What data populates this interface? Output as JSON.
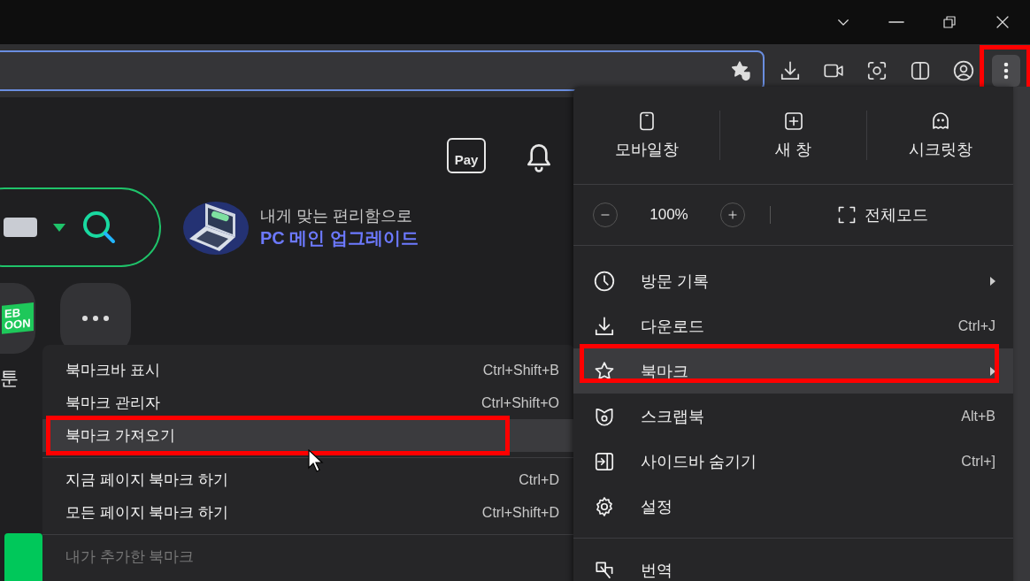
{
  "toolbar": {
    "menu_button": {
      "annotated": true
    }
  },
  "page": {
    "pay_label": "Pay",
    "banner": {
      "line_1": "내게 맞는 편리함으로",
      "line_2": "PC 메인 업그레이드"
    },
    "webtoon_logo": [
      "EB",
      "OON"
    ],
    "shortcut_label": "툰"
  },
  "main_menu": {
    "quick_actions": [
      {
        "label": "모바일창"
      },
      {
        "label": "새 창"
      },
      {
        "label": "시크릿창"
      }
    ],
    "zoom": {
      "value": "100%"
    },
    "fullscreen_label": "전체모드",
    "groups": [
      [
        {
          "label": "방문 기록",
          "has_submenu": true,
          "selected": false,
          "annotated": false
        },
        {
          "label": "다운로드",
          "shortcut": "Ctrl+J",
          "has_submenu": false,
          "selected": false,
          "annotated": false
        },
        {
          "label": "북마크",
          "has_submenu": true,
          "selected": true,
          "annotated": true
        },
        {
          "label": "스크랩북",
          "shortcut": "Alt+B",
          "has_submenu": false,
          "selected": false,
          "annotated": false
        },
        {
          "label": "사이드바 숨기기",
          "shortcut": "Ctrl+]",
          "has_submenu": false,
          "selected": false,
          "annotated": false
        },
        {
          "label": "설정",
          "has_submenu": false,
          "selected": false,
          "annotated": false
        }
      ],
      [
        {
          "label": "번역",
          "has_submenu": false,
          "selected": false,
          "annotated": false
        }
      ]
    ]
  },
  "bookmark_submenu": {
    "groups": [
      [
        {
          "label": "북마크바 표시",
          "shortcut": "Ctrl+Shift+B",
          "selected": false,
          "annotated": false,
          "disabled": false
        },
        {
          "label": "북마크 관리자",
          "shortcut": "Ctrl+Shift+O",
          "selected": false,
          "annotated": false,
          "disabled": false
        },
        {
          "label": "북마크 가져오기",
          "selected": true,
          "annotated": true,
          "disabled": false
        }
      ],
      [
        {
          "label": "지금 페이지 북마크 하기",
          "shortcut": "Ctrl+D",
          "selected": false,
          "annotated": false,
          "disabled": false
        },
        {
          "label": "모든 페이지 북마크 하기",
          "shortcut": "Ctrl+Shift+D",
          "selected": false,
          "annotated": false,
          "disabled": false
        }
      ],
      [
        {
          "label": "내가 추가한 북마크",
          "selected": false,
          "annotated": false,
          "disabled": true
        }
      ]
    ]
  }
}
